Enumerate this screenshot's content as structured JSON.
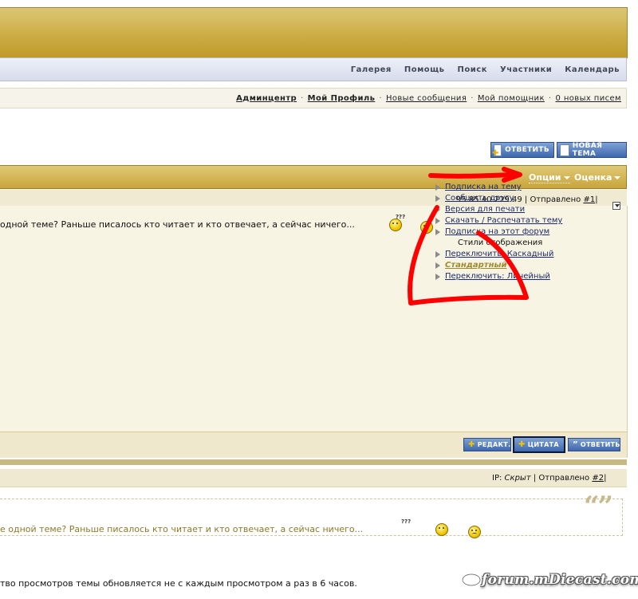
{
  "header": {
    "nav": [
      "Галерея",
      "Помощь",
      "Поиск",
      "Участники",
      "Календарь"
    ]
  },
  "userbar": {
    "admincenter": "Админцентр",
    "my_profile": "Мой Профиль",
    "new_posts": "Новые сообщения",
    "my_assistant": "Мой помощник",
    "new_messages": "0 новых писем",
    "separator": "·"
  },
  "buttons": {
    "reply": "ОТВЕТИТЬ",
    "new_topic": "НОВАЯ ТЕМА",
    "edit": "РЕДАКТ.",
    "quote": "ЦИТАТА",
    "reply_small": "ОТВЕТИТЬ"
  },
  "topic_header": {
    "options": "Опции",
    "rating": "Оценка"
  },
  "dropdown": {
    "items": [
      "Подписка на тему",
      "Сообщить другу",
      "Версия для печати",
      "Скачать / Распечатать тему",
      "Подписка на этот форум",
      "Стили отображения",
      "Переключить: Каскадный",
      "Стандартный",
      "Переключить: Линейный"
    ]
  },
  "post1": {
    "ip_partial": "95.85.40.229.49",
    "sent_label": "| Отправлено",
    "post_num": "#1",
    "post_sep": "|",
    "text": "одной теме? Раньше писалось кто читает и кто отвечает, а сейчас ничего...",
    "emoticon_text": "???"
  },
  "post2": {
    "ip_label": "IP:",
    "ip_value": "Скрыт",
    "sent_label": "| Отправлено",
    "post_num": "#2",
    "post_sep": "|",
    "quote_text": "е одной теме? Раньше писалось кто читает и кто отвечает, а сейчас ничего...",
    "quote_marks": "“”",
    "reply_text": "тво просмотров темы обновляется не с каждым просмотром а раз в 6 часов.",
    "emoticon_text": "???"
  },
  "watermark": "forum.mDiecast.com",
  "colors": {
    "gold": "#c9a53a",
    "nav_blue": "#d7dcec",
    "button_blue": "#3e68ae",
    "annotation_red": "#ff0000"
  }
}
